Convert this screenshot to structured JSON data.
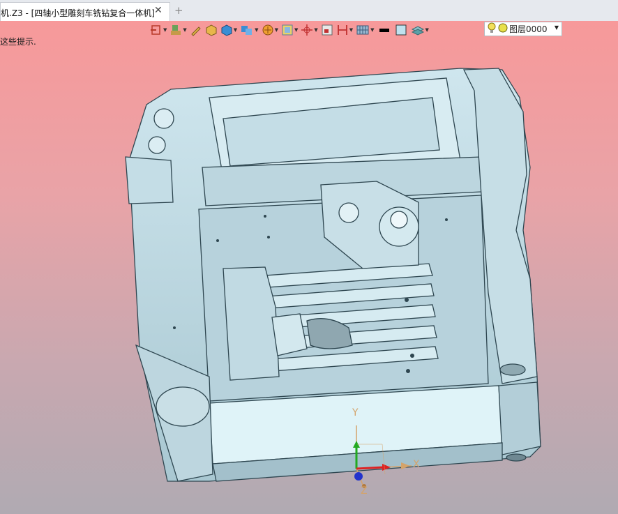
{
  "tab": {
    "title": "机.Z3 - [四轴小型雕刻车铣钻复合一体机]",
    "close": "✕",
    "add": "+"
  },
  "hint": "这些提示.",
  "toolbar": {
    "icons": [
      "exit-icon",
      "brush-icon",
      "pencil-icon",
      "solid-shade-icon",
      "box-icon",
      "view-cube-icon",
      "render-icon",
      "frame-icon",
      "origin-icon",
      "window-icon",
      "bracket-icon",
      "grid-icon",
      "black-line-icon",
      "color-swatch-icon",
      "layer-stack-icon"
    ],
    "layer_value": "图层0000"
  },
  "axes": {
    "x_label": "X",
    "y_label": "Y",
    "z_label": "Z"
  }
}
